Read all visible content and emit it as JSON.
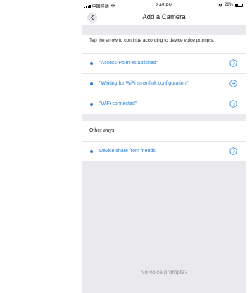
{
  "status_bar": {
    "carrier": "中国移动",
    "time": "2:45 PM",
    "battery": "28%",
    "battery_level": 0.28
  },
  "nav": {
    "title": "Add a Camera"
  },
  "instructions": "Tap the arrow to continue according to device voice prompts.",
  "prompts": [
    {
      "label": "\"Access-Point established\""
    },
    {
      "label": "\"Waiting for WiFi smartlink configuration\""
    },
    {
      "label": "\"WiFi connected\""
    }
  ],
  "other_ways": {
    "title": "Other ways",
    "items": [
      {
        "label": "Device share from friends."
      }
    ]
  },
  "footer_link": "No voice prompts?",
  "colors": {
    "accent": "#2a7fd4",
    "background": "#e9e9ee",
    "muted": "#8e8e93"
  }
}
